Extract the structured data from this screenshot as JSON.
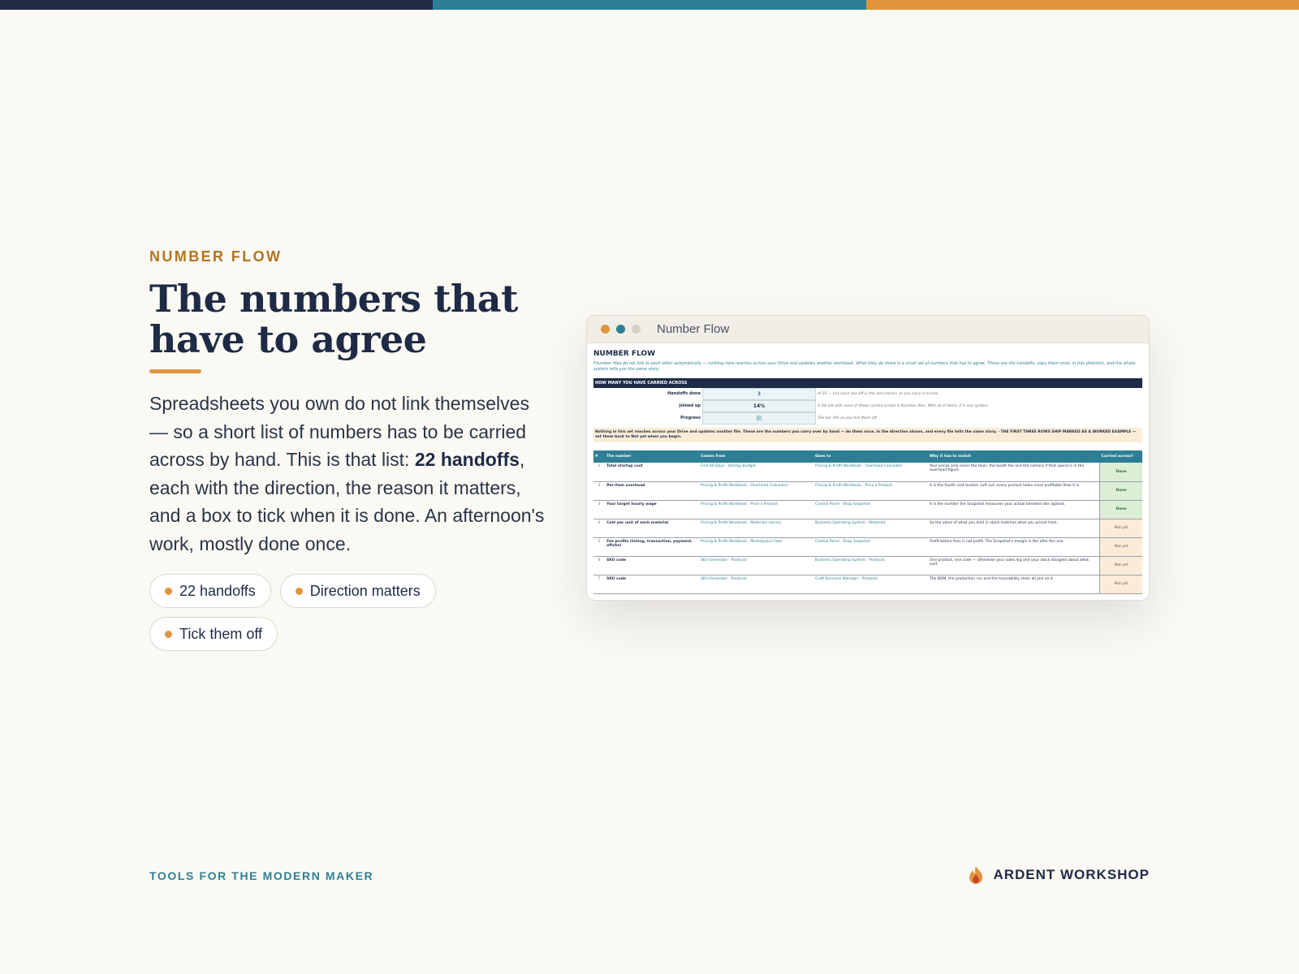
{
  "colors": {
    "navy": "#1e2a46",
    "teal": "#2e7f95",
    "orange": "#e0953c",
    "background": "#fbf9f3"
  },
  "hero": {
    "eyebrow": "NUMBER FLOW",
    "title_line1": "The numbers that",
    "title_line2": "have to agree",
    "body_part1": "Spreadsheets you own do not link themselves — so a short list of numbers has to be carried across by hand. This is that list: ",
    "body_bold": "22 handoffs",
    "body_part2": ", each with the direction, the reason it matters, and a box to tick when it is done. An afternoon's work, mostly done once.",
    "chips": [
      "22 handoffs",
      "Direction matters",
      "Tick them off"
    ]
  },
  "window": {
    "title": "Number Flow",
    "sheet": {
      "title": "NUMBER FLOW",
      "subtitle": "Fourteen files do not link to each other automatically — nothing here reaches across your Drive and updates another workbook. What they do share is a small set of numbers that has to agree. These are the handoffs; copy them once, in this direction, and the whole system tells you the same story.",
      "band": "HOW MANY YOU HAVE CARRIED ACROSS",
      "stats": [
        {
          "label": "Handoffs done",
          "value": "3",
          "note": "of 22 — tick each one off in the last column as you carry it across."
        },
        {
          "label": "Joined up",
          "value": "14%",
          "note": "A file set with none of these carried across is fourteen files. With all of them, it is one system."
        },
        {
          "label": "Progress",
          "value": "|||",
          "note": "The bar fills as you tick them off."
        }
      ],
      "warning": "Nothing in this set reaches across your Drive and updates another file. These are the numbers you carry over by hand — do them once, in the direction shown, and every file tells the same story. · THE FIRST THREE ROWS SHIP MARKED AS A WORKED EXAMPLE — set them back to Not yet when you begin.",
      "headers": [
        "#",
        "The number",
        "Comes from",
        "Goes to",
        "Why it has to match",
        "Carried across?"
      ],
      "rows": [
        {
          "n": "1",
          "name": "Total startup cost",
          "from": "First 90 Days · Startup Budget",
          "to": "Pricing & Profit Workbook · Overhead Calculator",
          "why": "Your prices only cover the tools, the booth fee and the camera if that spend is in the overhead figure.",
          "status": "Done"
        },
        {
          "n": "2",
          "name": "Per-item overhead",
          "from": "Pricing & Profit Workbook · Overhead Calculator",
          "to": "Pricing & Profit Workbook · Price a Product",
          "why": "It is the fourth cost bucket. Left out, every product looks more profitable than it is.",
          "status": "Done"
        },
        {
          "n": "3",
          "name": "Your target hourly wage",
          "from": "Pricing & Profit Workbook · Price a Product",
          "to": "Control Panel · Shop Snapshot",
          "why": "It is the number the Snapshot measures your actual blended rate against.",
          "status": "Done"
        },
        {
          "n": "4",
          "name": "Cost per unit of each material",
          "from": "Pricing & Profit Workbook · Materials Library",
          "to": "Business Operating System · Materials",
          "why": "So the value of what you hold in stock matches what you priced from.",
          "status": "Not yet"
        },
        {
          "n": "5",
          "name": "Fee profile (listing, transaction, payment, offsite)",
          "from": "Pricing & Profit Workbook · Marketplace Fees",
          "to": "Control Panel · Shop Snapshot",
          "why": "Profit before fees is not profit. The Snapshot's margin is the after-fee one.",
          "status": "Not yet"
        },
        {
          "n": "6",
          "name": "SKU code",
          "from": "SKU Generator · Products",
          "to": "Business Operating System · Products",
          "why": "One product, one code — otherwise your sales log and your stock disagree about what sold.",
          "status": "Not yet"
        },
        {
          "n": "7",
          "name": "SKU code",
          "from": "SKU Generator · Products",
          "to": "Craft Business Manager · Products",
          "why": "The BOM, the production run and the traceability chain all join on it.",
          "status": "Not yet"
        }
      ]
    }
  },
  "footer": {
    "tagline": "TOOLS FOR THE MODERN MAKER",
    "brand": "ARDENT WORKSHOP",
    "brand_icon": "flame-icon"
  }
}
